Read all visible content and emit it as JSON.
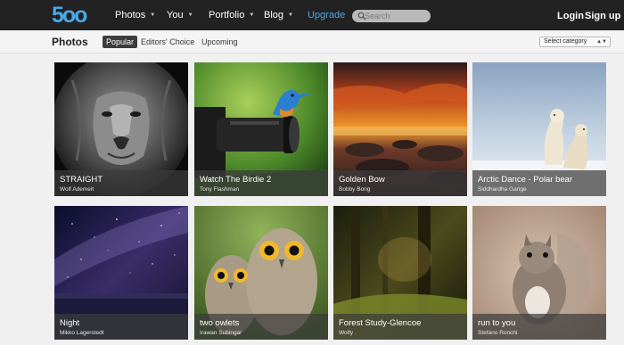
{
  "nav": {
    "logo": "5oo",
    "items": [
      {
        "label": "Photos",
        "caret": "▼"
      },
      {
        "label": "You",
        "caret": "▼"
      },
      {
        "label": "Portfolio",
        "caret": "▼"
      },
      {
        "label": "Blog",
        "caret": "▼"
      }
    ],
    "upgrade": "Upgrade",
    "search_placeholder": "Search",
    "login": "Login",
    "signup": "Sign up"
  },
  "subheader": {
    "title": "Photos",
    "filters": [
      "Popular",
      "Editors' Choice",
      "Upcoming"
    ],
    "active_filter": "Popular",
    "category_select": "Select category"
  },
  "photos": [
    {
      "title": "STRAIGHT",
      "author": "Wolf Ademeit"
    },
    {
      "title": "Watch The Birdie 2",
      "author": "Tony Flashman"
    },
    {
      "title": "Golden Bow",
      "author": "Bobby Bong"
    },
    {
      "title": "Arctic Dance - Polar bear",
      "author": "Siddhardha Garige"
    },
    {
      "title": "Night",
      "author": "Mikko Lagerstedt"
    },
    {
      "title": "two owlets",
      "author": "Irawan Subingar"
    },
    {
      "title": "Forest Study-Glencoe",
      "author": "Wolfy ."
    },
    {
      "title": "run to you",
      "author": "Stefano Ronchi"
    }
  ],
  "colors": {
    "nav_bg": "#222222",
    "accent_blue": "#48a9e6",
    "page_bg": "#f0f0f0",
    "caption_overlay": "#3c3c3c"
  }
}
